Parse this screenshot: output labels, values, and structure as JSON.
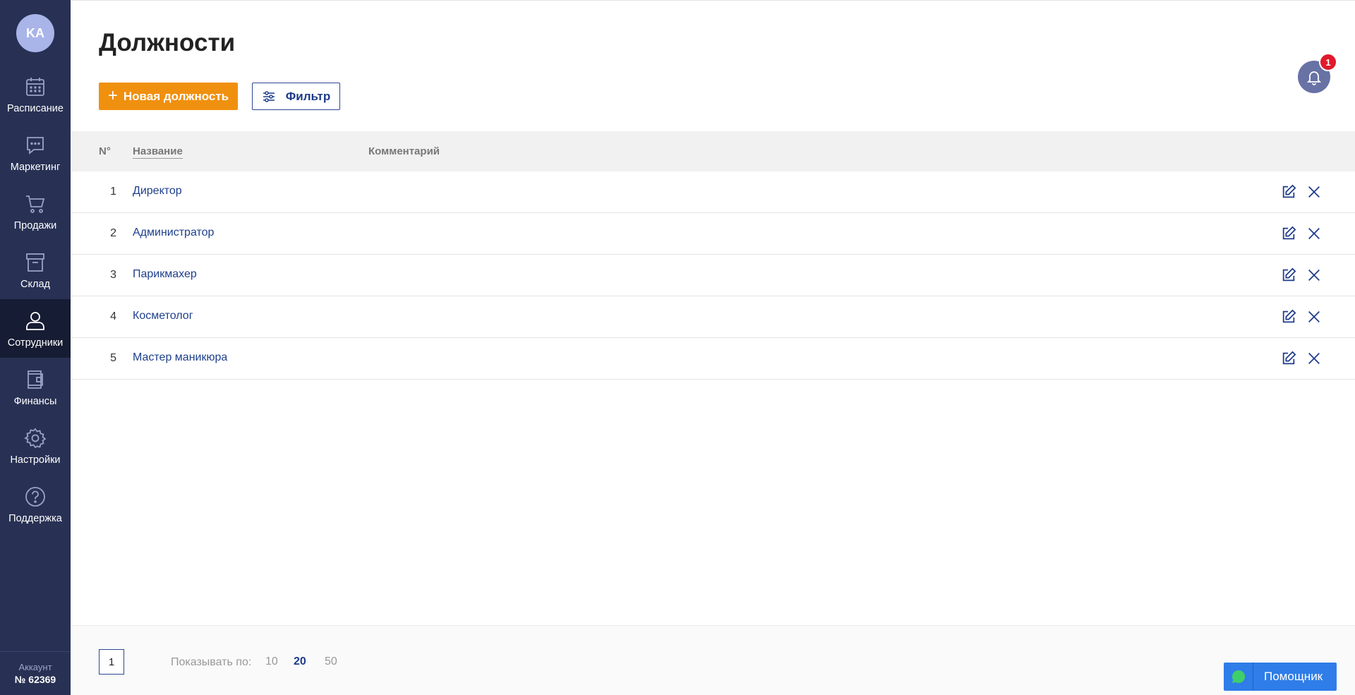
{
  "sidebar": {
    "avatar_initials": "KA",
    "items": [
      {
        "label": "Расписание",
        "icon": "calendar-icon"
      },
      {
        "label": "Маркетинг",
        "icon": "chat-bubble-icon"
      },
      {
        "label": "Продажи",
        "icon": "cart-icon"
      },
      {
        "label": "Склад",
        "icon": "archive-box-icon"
      },
      {
        "label": "Сотрудники",
        "icon": "user-icon"
      },
      {
        "label": "Финансы",
        "icon": "wallet-icon"
      },
      {
        "label": "Настройки",
        "icon": "gear-icon"
      },
      {
        "label": "Поддержка",
        "icon": "question-icon"
      }
    ],
    "active_item": "Сотрудники",
    "account_label": "Аккаунт",
    "account_number": "№ 62369"
  },
  "header": {
    "title": "Должности",
    "new_button_label": "Новая должность",
    "filter_button_label": "Фильтр",
    "notification_count": "1"
  },
  "table": {
    "columns": {
      "no": "N°",
      "name": "Название",
      "comment": "Комментарий"
    },
    "rows": [
      {
        "no": "1",
        "name": "Директор",
        "comment": ""
      },
      {
        "no": "2",
        "name": "Администратор",
        "comment": ""
      },
      {
        "no": "3",
        "name": "Парикмахер",
        "comment": ""
      },
      {
        "no": "4",
        "name": "Косметолог",
        "comment": ""
      },
      {
        "no": "5",
        "name": "Мастер маникюра",
        "comment": ""
      }
    ]
  },
  "pagination": {
    "current_page": "1",
    "show_label": "Показывать по:",
    "sizes": [
      "10",
      "20",
      "50"
    ],
    "active_size": "20"
  },
  "helper": {
    "label": "Помощник"
  },
  "colors": {
    "sidebar_bg": "#283154",
    "sidebar_active_bg": "#161c33",
    "accent_orange": "#f0900f",
    "link_blue": "#1e3f8c",
    "helper_blue": "#2f7de8",
    "badge_red": "#e01a2b"
  }
}
